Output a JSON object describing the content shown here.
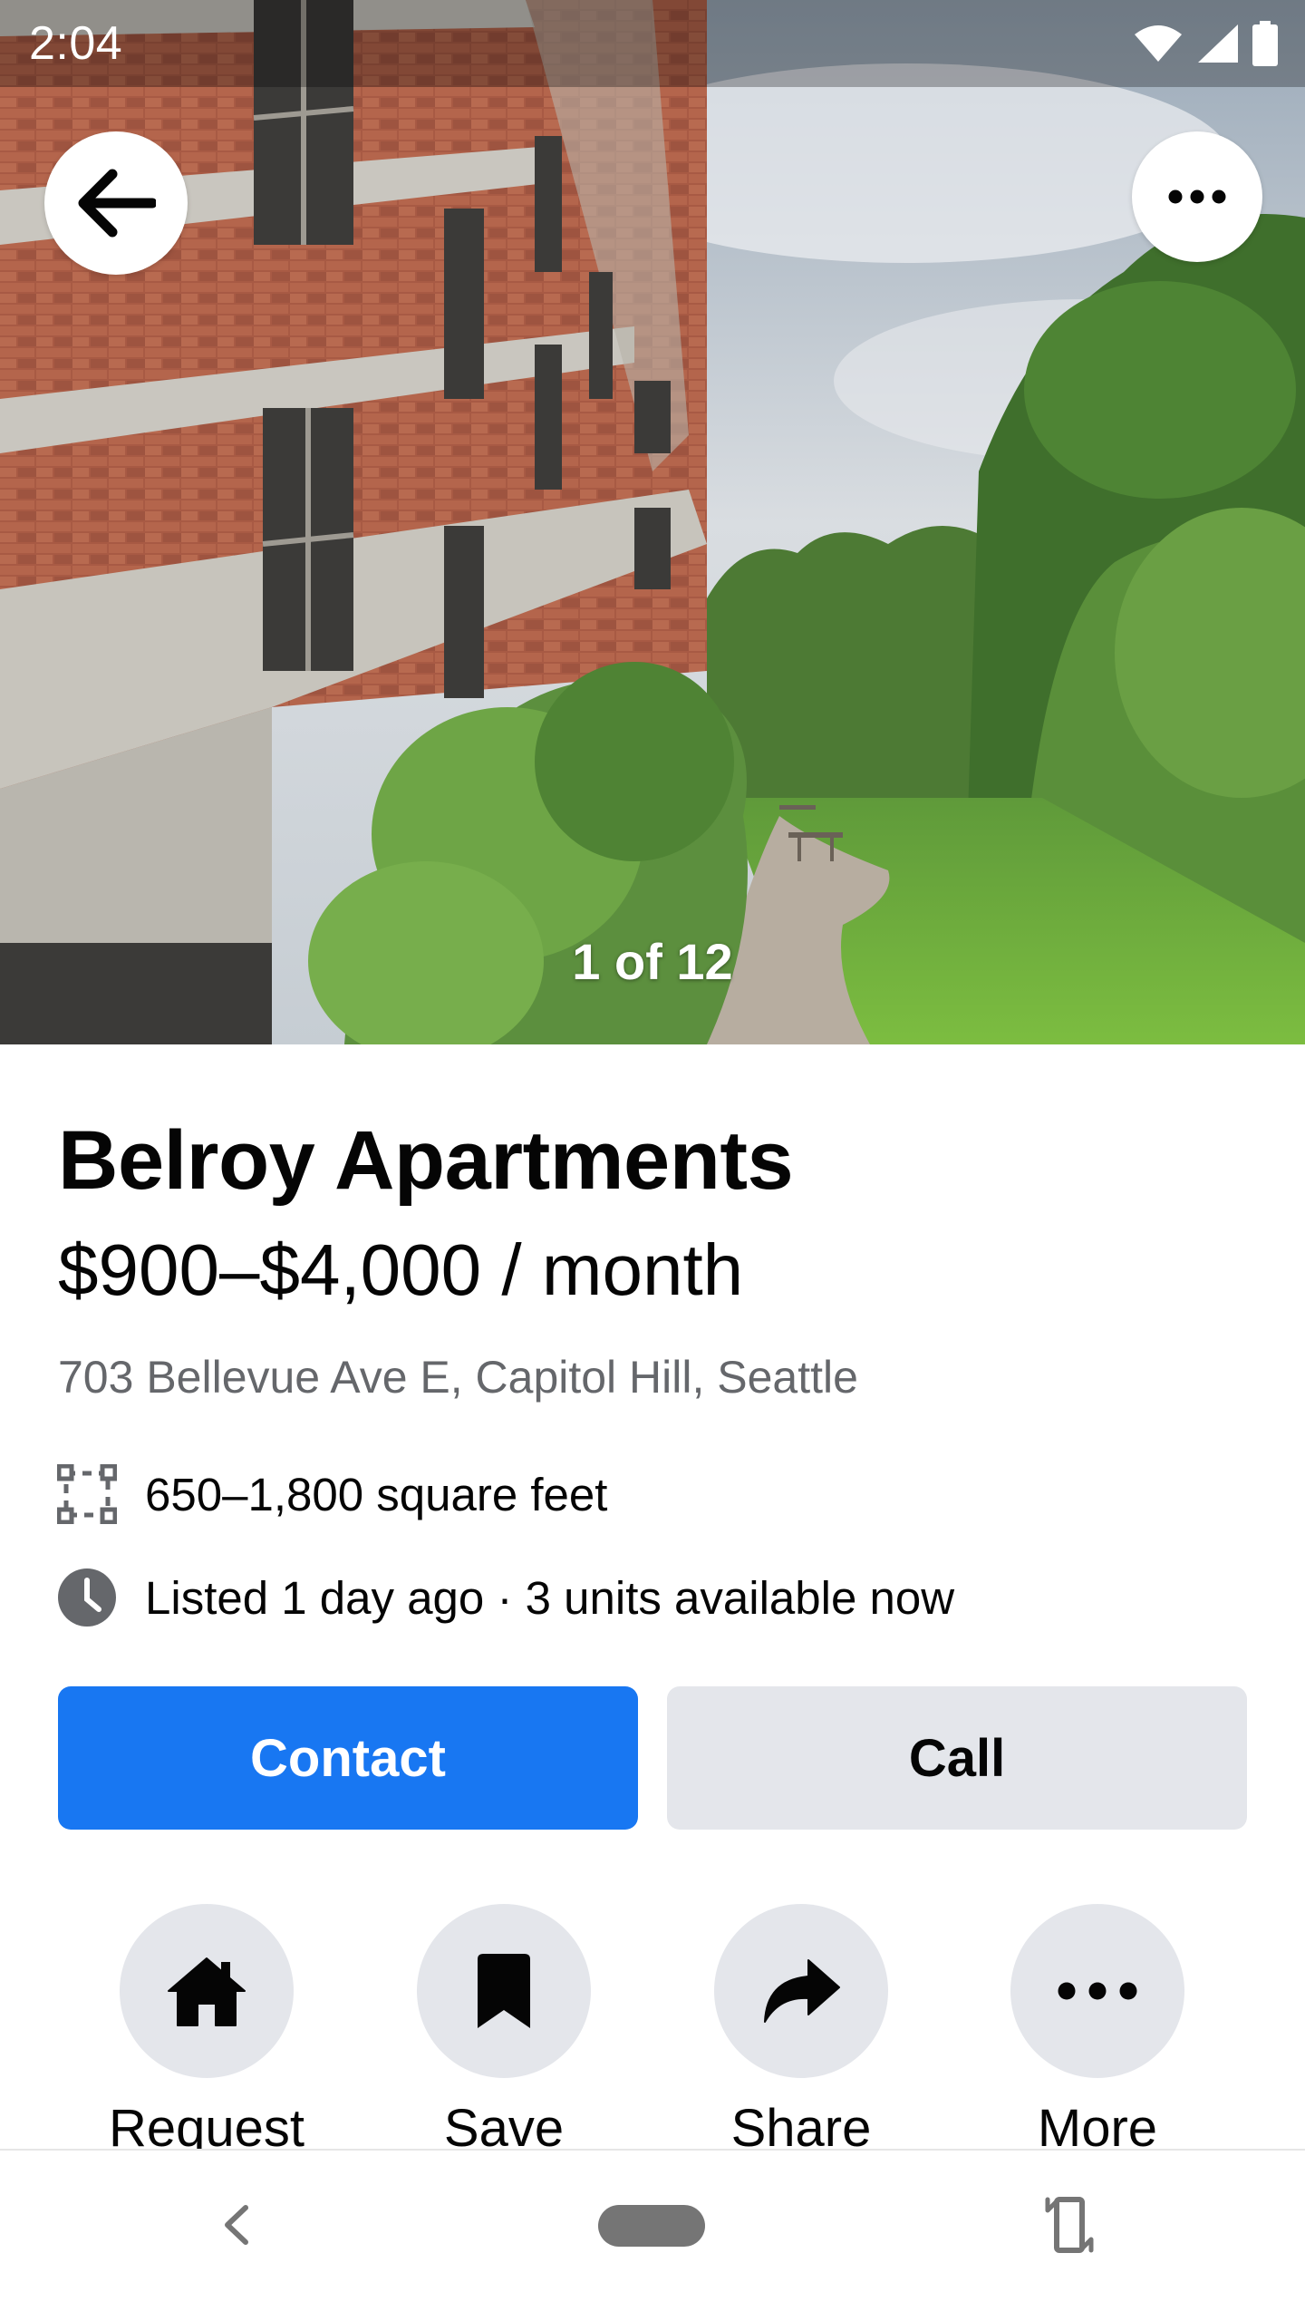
{
  "status_bar": {
    "time": "2:04",
    "icons": [
      "wifi-icon",
      "cell-signal-icon",
      "battery-icon"
    ]
  },
  "hero": {
    "photo_counter": "1 of 12",
    "back_icon": "arrow-left-icon",
    "more_icon": "more-horizontal-icon"
  },
  "listing": {
    "title": "Belroy Apartments",
    "price": "$900–$4,000 / month",
    "address": "703 Bellevue Ave E, Capitol Hill, Seattle",
    "size": "650–1,800 square feet",
    "listed": "Listed 1 day ago · 3 units available now"
  },
  "buttons": {
    "contact": "Contact",
    "call": "Call"
  },
  "actions": [
    {
      "label": "Request",
      "icon": "home-icon"
    },
    {
      "label": "Save",
      "icon": "bookmark-icon"
    },
    {
      "label": "Share",
      "icon": "share-icon"
    },
    {
      "label": "More",
      "icon": "more-horizontal-icon"
    }
  ],
  "colors": {
    "primary": "#1877f2",
    "secondary_button": "#e4e6eb",
    "text_primary": "#050505",
    "text_secondary": "#65676b"
  }
}
